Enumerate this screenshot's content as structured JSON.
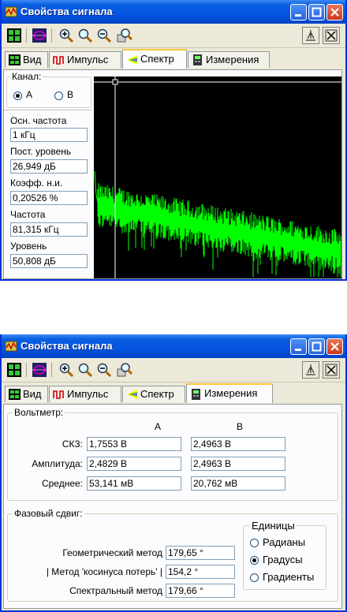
{
  "window1": {
    "title": "Свойства сигнала",
    "tabs": [
      {
        "label": "Вид",
        "icon": "view-icon"
      },
      {
        "label": "Импульс",
        "icon": "pulse-icon"
      },
      {
        "label": "Спектр",
        "icon": "spectrum-icon"
      },
      {
        "label": "Измерения",
        "icon": "measure-icon"
      }
    ],
    "active_tab": "Спектр",
    "channel": {
      "label": "Канал:",
      "options": [
        "A",
        "B"
      ],
      "selected": "A"
    },
    "fields": [
      {
        "label": "Осн. частота",
        "value": "1 кГц"
      },
      {
        "label": "Пост. уровень",
        "value": "26,949 дБ"
      },
      {
        "label": "Коэфф. н.и.",
        "value": "0,20526 %"
      },
      {
        "label": "Частота",
        "value": "81,315 кГц"
      },
      {
        "label": "Уровень",
        "value": "50,808 дБ"
      }
    ],
    "spectrum_colors": {
      "background": "#000000",
      "trace": "#00ff00",
      "cursor": "#ffffff"
    }
  },
  "window2": {
    "title": "Свойства сигнала",
    "tabs": [
      {
        "label": "Вид",
        "icon": "view-icon"
      },
      {
        "label": "Импульс",
        "icon": "pulse-icon"
      },
      {
        "label": "Спектр",
        "icon": "spectrum-icon"
      },
      {
        "label": "Измерения",
        "icon": "measure-icon"
      }
    ],
    "active_tab": "Измерения",
    "voltmeter": {
      "legend": "Вольтметр:",
      "col_a": "A",
      "col_b": "B",
      "rows": [
        {
          "label": "СКЗ:",
          "a": "1,7553 В",
          "b": "2,4963 В"
        },
        {
          "label": "Амплитуда:",
          "a": "2,4829 В",
          "b": "2,4963 В"
        },
        {
          "label": "Среднее:",
          "a": "53,141 мВ",
          "b": "20,762 мВ"
        }
      ]
    },
    "phase": {
      "legend": "Фазовый сдвиг:",
      "rows": [
        {
          "label": "Геометрический метод",
          "value": "179,65 °"
        },
        {
          "label": "| Метод 'косинуса потерь' |",
          "value": "154,2 °"
        },
        {
          "label": "Спектральный метод",
          "value": "179,66 °"
        }
      ],
      "units": {
        "legend": "Единицы",
        "options": [
          "Радианы",
          "Градусы",
          "Градиенты"
        ],
        "selected": "Градусы"
      }
    }
  },
  "colors": {
    "titlebar": "#0554e3",
    "close": "#c7391b",
    "tab_highlight": "#ffc83c"
  }
}
